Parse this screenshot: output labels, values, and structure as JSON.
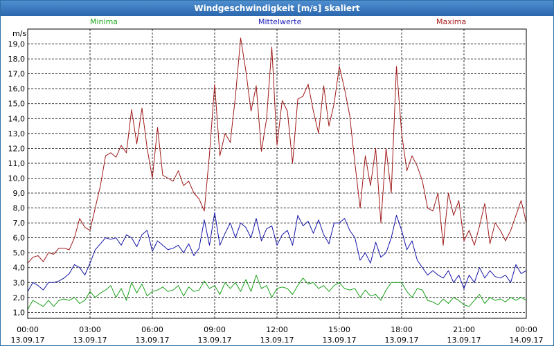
{
  "window": {
    "title": "Windgeschwindigkeit [m/s] skaliert"
  },
  "chart_data": {
    "type": "line",
    "title": "Windgeschwindigkeit [m/s] skaliert",
    "ylabel": "m/s",
    "ylim": [
      0.6,
      20.0
    ],
    "yticks": [
      "1,0",
      "2,0",
      "3,0",
      "4,0",
      "5,0",
      "6,0",
      "7,0",
      "8,0",
      "9,0",
      "10,0",
      "11,0",
      "12,0",
      "13,0",
      "14,0",
      "15,0",
      "16,0",
      "17,0",
      "18,0",
      "19,0"
    ],
    "ytick_values": [
      1,
      2,
      3,
      4,
      5,
      6,
      7,
      8,
      9,
      10,
      11,
      12,
      13,
      14,
      15,
      16,
      17,
      18,
      19
    ],
    "xticks": [
      {
        "time": "00:00",
        "date": "13.09.17"
      },
      {
        "time": "03:00",
        "date": "13.09.17"
      },
      {
        "time": "06:00",
        "date": "13.09.17"
      },
      {
        "time": "09:00",
        "date": "13.09.17"
      },
      {
        "time": "12:00",
        "date": "13.09.17"
      },
      {
        "time": "15:00",
        "date": "13.09.17"
      },
      {
        "time": "18:00",
        "date": "13.09.17"
      },
      {
        "time": "21:00",
        "date": "13.09.17"
      },
      {
        "time": "00:00",
        "date": "14.09.17"
      }
    ],
    "grid": true,
    "x_hours": [
      0,
      0.25,
      0.5,
      0.75,
      1,
      1.25,
      1.5,
      1.75,
      2,
      2.25,
      2.5,
      2.75,
      3,
      3.25,
      3.5,
      3.75,
      4,
      4.25,
      4.5,
      4.75,
      5,
      5.25,
      5.5,
      5.75,
      6,
      6.25,
      6.5,
      6.75,
      7,
      7.25,
      7.5,
      7.75,
      8,
      8.25,
      8.5,
      8.75,
      9,
      9.25,
      9.5,
      9.75,
      10,
      10.25,
      10.5,
      10.75,
      11,
      11.25,
      11.5,
      11.75,
      12,
      12.25,
      12.5,
      12.75,
      13,
      13.25,
      13.5,
      13.75,
      14,
      14.25,
      14.5,
      14.75,
      15,
      15.25,
      15.5,
      15.75,
      16,
      16.25,
      16.5,
      16.75,
      17,
      17.25,
      17.5,
      17.75,
      18,
      18.25,
      18.5,
      18.75,
      19,
      19.25,
      19.5,
      19.75,
      20,
      20.25,
      20.5,
      20.75,
      21,
      21.25,
      21.5,
      21.75,
      22,
      22.25,
      22.5,
      22.75,
      23,
      23.25,
      23.5,
      23.75,
      24
    ],
    "series": [
      {
        "name": "Maxima",
        "color": "#a01818",
        "values": [
          4.3,
          4.7,
          4.8,
          4.4,
          5.0,
          4.9,
          5.3,
          5.3,
          5.2,
          6.0,
          7.3,
          6.7,
          6.5,
          8.0,
          9.5,
          11.5,
          11.7,
          11.4,
          12.2,
          11.7,
          14.6,
          12.3,
          14.7,
          12.0,
          10.0,
          13.4,
          10.2,
          10.0,
          9.8,
          10.5,
          9.5,
          9.8,
          9.0,
          8.6,
          7.8,
          11.6,
          16.3,
          11.5,
          13.0,
          12.4,
          15.5,
          19.4,
          17.2,
          14.5,
          16.2,
          11.8,
          14.0,
          18.8,
          12.2,
          15.2,
          14.5,
          11.0,
          15.3,
          15.5,
          16.3,
          14.5,
          13.0,
          16.2,
          13.5,
          15.0,
          17.5,
          16.0,
          14.2,
          11.0,
          8.0,
          11.5,
          9.5,
          12.0,
          7.0,
          12.0,
          9.0,
          17.5,
          13.0,
          10.5,
          11.5,
          10.8,
          9.8,
          8.0,
          7.8,
          9.0,
          5.5,
          9.0,
          7.5,
          8.5,
          5.8,
          6.5,
          5.5,
          6.8,
          8.3,
          5.6,
          7.0,
          6.5,
          5.8,
          6.5,
          7.5,
          8.5,
          7.0,
          9.8,
          6.8
        ]
      },
      {
        "name": "Mittelwerte",
        "color": "#1414a8",
        "values": [
          2.4,
          3.0,
          2.8,
          2.5,
          3.0,
          3.0,
          3.1,
          3.3,
          3.6,
          4.2,
          4.0,
          3.5,
          4.3,
          5.2,
          5.6,
          6.0,
          5.9,
          6.0,
          5.5,
          6.2,
          6.0,
          5.4,
          6.2,
          6.5,
          5.1,
          5.8,
          5.5,
          5.2,
          5.3,
          5.5,
          5.0,
          5.6,
          4.8,
          5.3,
          7.2,
          5.5,
          7.7,
          5.5,
          6.3,
          7.0,
          6.0,
          7.0,
          6.7,
          6.0,
          7.3,
          5.8,
          6.6,
          6.8,
          5.5,
          6.2,
          6.5,
          5.5,
          7.5,
          6.8,
          7.1,
          6.3,
          7.2,
          6.2,
          5.6,
          7.0,
          7.0,
          7.3,
          6.5,
          6.0,
          4.5,
          5.0,
          4.3,
          5.7,
          4.7,
          5.0,
          6.0,
          7.5,
          6.5,
          5.2,
          5.8,
          4.5,
          4.0,
          3.5,
          3.8,
          3.5,
          3.3,
          3.8,
          3.0,
          3.5,
          2.6,
          3.5,
          3.0,
          4.0,
          3.3,
          3.8,
          3.4,
          3.3,
          3.5,
          3.0,
          4.2,
          3.6,
          3.8,
          4.5,
          4.0
        ]
      },
      {
        "name": "Minima",
        "color": "#18a018",
        "values": [
          1.2,
          1.8,
          1.6,
          1.4,
          1.8,
          1.4,
          1.8,
          1.9,
          1.8,
          2.0,
          1.6,
          1.8,
          2.4,
          2.0,
          2.3,
          2.5,
          2.8,
          2.0,
          2.6,
          1.8,
          3.0,
          2.3,
          2.9,
          2.1,
          2.4,
          2.5,
          2.7,
          2.4,
          2.5,
          2.8,
          2.1,
          2.7,
          2.4,
          2.5,
          3.1,
          2.6,
          2.8,
          2.2,
          3.0,
          2.6,
          3.0,
          2.4,
          3.2,
          2.4,
          3.5,
          2.6,
          2.8,
          2.0,
          2.6,
          2.7,
          2.6,
          2.2,
          2.8,
          3.3,
          2.9,
          3.0,
          2.6,
          2.8,
          2.4,
          2.8,
          3.0,
          2.6,
          2.5,
          2.6,
          2.0,
          2.5,
          2.1,
          2.2,
          1.8,
          2.5,
          3.0,
          3.0,
          3.0,
          2.4,
          2.0,
          2.6,
          2.5,
          1.8,
          1.7,
          1.5,
          1.9,
          1.6,
          2.0,
          1.8,
          1.5,
          1.4,
          1.8,
          2.2,
          1.6,
          2.0,
          1.8,
          1.9,
          1.7,
          2.0,
          1.8,
          2.0,
          1.8,
          2.3,
          1.9
        ]
      }
    ]
  }
}
